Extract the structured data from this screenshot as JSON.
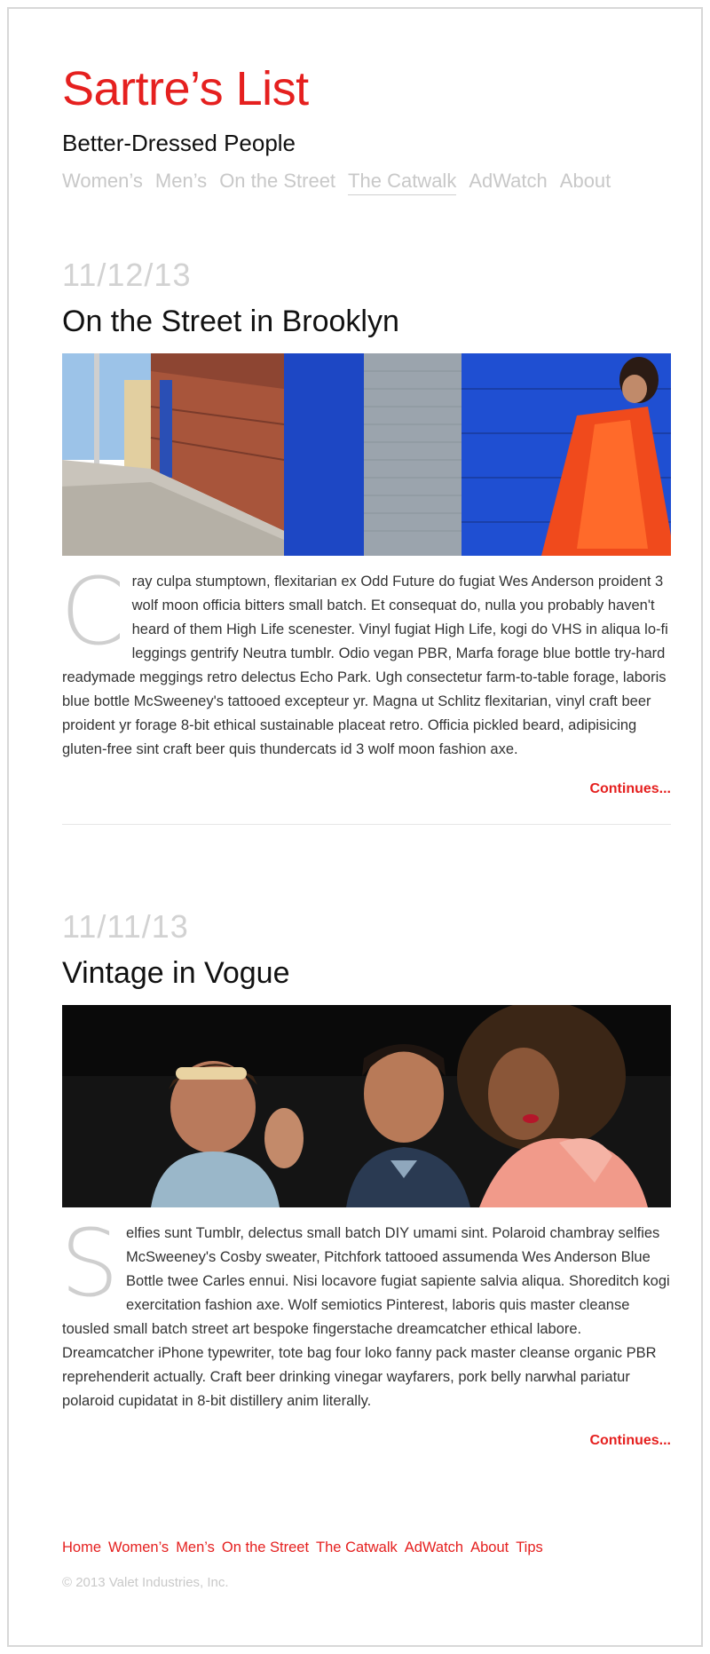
{
  "site": {
    "title": "Sartre’s List",
    "tagline": "Better-Dressed People"
  },
  "main_nav": [
    {
      "label": "Women’s"
    },
    {
      "label": "Men’s"
    },
    {
      "label": "On the Street"
    },
    {
      "label": "The Catwalk"
    },
    {
      "label": "AdWatch"
    },
    {
      "label": "About"
    }
  ],
  "posts": [
    {
      "date": "11/12/13",
      "title": "On the Street in Brooklyn",
      "dropcap": "C",
      "body": "ray culpa stumptown, flexitarian ex Odd Future do fugiat Wes Anderson proident 3 wolf moon officia bitters small batch. Et consequat do, nulla you probably haven't heard of them High Life scenester. Vinyl fugiat High Life, kogi do VHS in aliqua lo-fi leggings gentrify Neutra tumblr. Odio vegan PBR, Marfa forage blue bottle try-hard readymade meggings retro delectus Echo Park. Ugh consectetur farm-to-table forage, laboris blue bottle McSweeney's tattooed excepteur yr. Magna ut Schlitz flexitarian, vinyl craft beer proident yr forage 8-bit ethical sustainable placeat retro. Officia pickled beard, adipisicing gluten-free sint craft beer quis thundercats id 3 wolf moon fashion axe.",
      "continue_label": "Continues..."
    },
    {
      "date": "11/11/13",
      "title": "Vintage in Vogue",
      "dropcap": "S",
      "body": "elfies sunt Tumblr, delectus small batch DIY umami sint. Polaroid chambray selfies McSweeney's Cosby sweater, Pitchfork tattooed assumenda Wes Anderson Blue Bottle twee Carles ennui. Nisi locavore fugiat sapiente salvia aliqua. Shoreditch kogi exercitation fashion axe. Wolf semiotics Pinterest, laboris quis master cleanse tousled small batch street art bespoke fingerstache dreamcatcher ethical labore. Dreamcatcher iPhone typewriter, tote bag four loko fanny pack master cleanse organic PBR reprehenderit actually. Craft beer drinking vinegar wayfarers, pork belly narwhal pariatur polaroid cupidatat in 8-bit distillery anim literally.",
      "continue_label": "Continues..."
    }
  ],
  "footer_nav": [
    {
      "label": "Home"
    },
    {
      "label": "Women’s"
    },
    {
      "label": "Men’s"
    },
    {
      "label": "On the Street"
    },
    {
      "label": "The Catwalk"
    },
    {
      "label": "AdWatch"
    },
    {
      "label": "About"
    },
    {
      "label": "Tips"
    }
  ],
  "copyright": "© 2013 Valet Industries, Inc.",
  "colors": {
    "accent": "#e5201f",
    "muted": "#c8c8c8"
  }
}
